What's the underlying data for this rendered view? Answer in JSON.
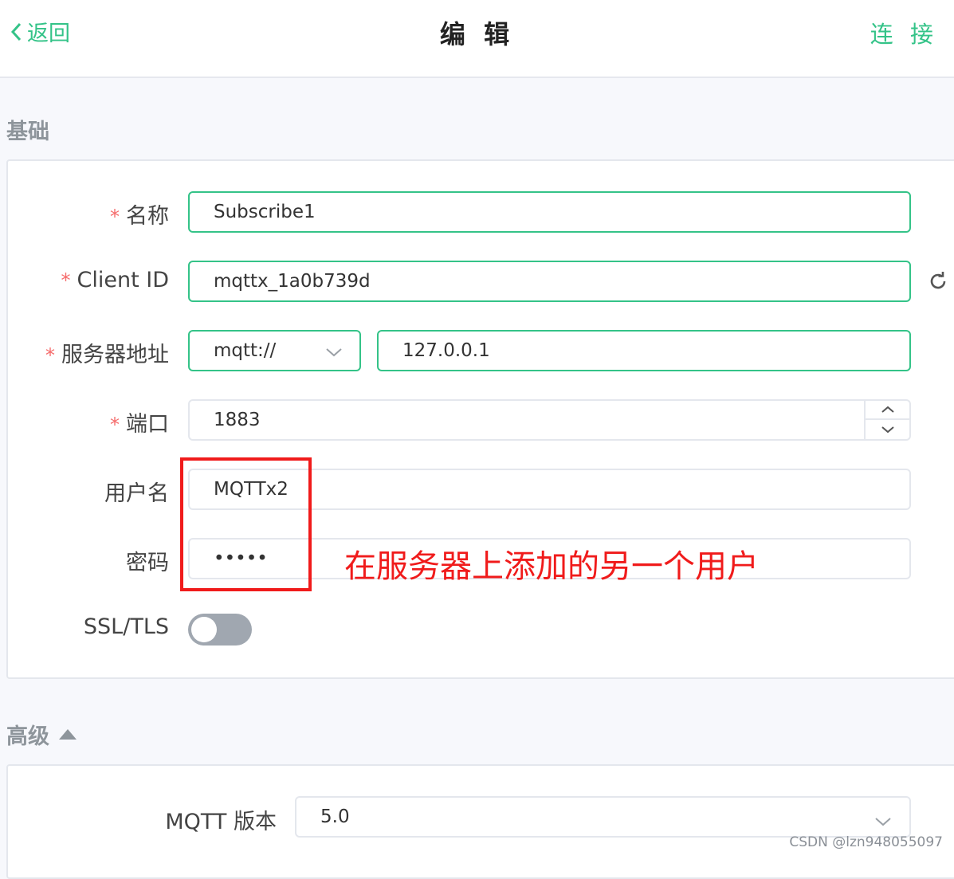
{
  "header": {
    "back_label": "返回",
    "title": "编 辑",
    "connect_label": "连 接"
  },
  "basic": {
    "section_title": "基础",
    "name": {
      "label": "名称",
      "required": "*",
      "value": "Subscribe1"
    },
    "client_id": {
      "label": "Client ID",
      "required": "*",
      "value": "mqttx_1a0b739d"
    },
    "server": {
      "label": "服务器地址",
      "required": "*",
      "protocol": "mqtt://",
      "host": "127.0.0.1"
    },
    "port": {
      "label": "端口",
      "required": "*",
      "value": "1883"
    },
    "username": {
      "label": "用户名",
      "value": "MQTTx2"
    },
    "password": {
      "label": "密码",
      "value": "•••••"
    },
    "ssl": {
      "label": "SSL/TLS",
      "enabled": false
    }
  },
  "advanced": {
    "section_title": "高级",
    "mqtt_version": {
      "label": "MQTT 版本",
      "value": "5.0"
    }
  },
  "annotation": {
    "text": "在服务器上添加的另一个用户"
  },
  "watermark": "CSDN @lzn948055097",
  "colors": {
    "accent": "#34c388",
    "required": "#f56c6c",
    "annotation": "#f01b1b"
  },
  "icons": [
    "chevron-left-icon",
    "refresh-icon",
    "chevron-down-icon",
    "chevron-up-icon",
    "caret-up-icon"
  ]
}
